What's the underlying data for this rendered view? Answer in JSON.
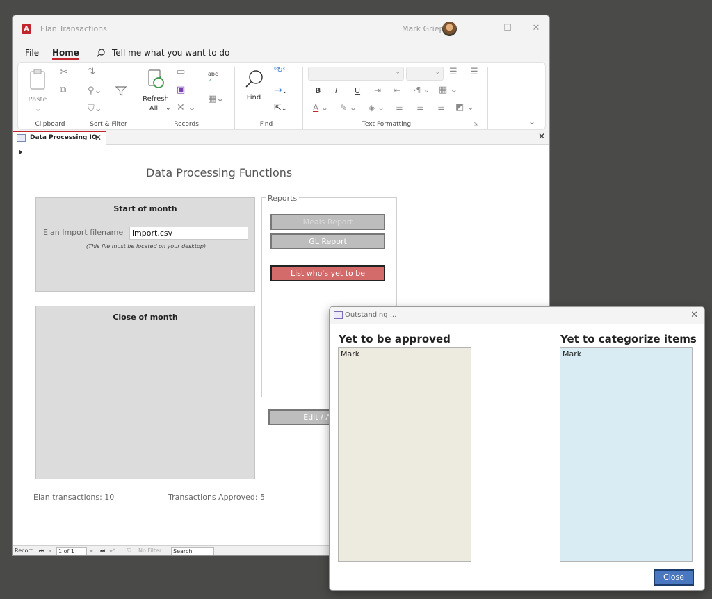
{
  "window": {
    "title": "Elan Transactions",
    "user": "Mark Griep",
    "app_icon_letter": "A",
    "controls": [
      "—",
      "☐",
      "✕"
    ]
  },
  "menu": {
    "file": "File",
    "home": "Home",
    "tell_me": "Tell me what you want to do"
  },
  "ribbon": {
    "groups": {
      "clipboard": "Clipboard",
      "sort_filter": "Sort & Filter",
      "records": "Records",
      "find": "Find",
      "text_formatting": "Text Formatting"
    },
    "buttons": {
      "paste": "Paste",
      "refresh": "Refresh",
      "refresh_all": "All",
      "find": "Find",
      "bold": "B",
      "italic": "I",
      "underline": "U"
    }
  },
  "document_tab": {
    "label": "Data Processing IO"
  },
  "form": {
    "title": "Data Processing Functions",
    "start_of_month": {
      "heading": "Start of month",
      "import_label": "Elan Import filename",
      "import_value": "import.csv",
      "note": "(This file must be located on your desktop)"
    },
    "close_of_month": {
      "heading": "Close of month"
    },
    "reports": {
      "legend": "Reports",
      "meals_report": "Meals Report",
      "gl_report": "GL Report",
      "list_unapproved": "List who's yet to be approved"
    },
    "edit_button": "Edit / Add C",
    "stats": {
      "elan_transactions": "Elan transactions: 10",
      "transactions_approved": "Transactions Approved:  5"
    }
  },
  "record_bar": {
    "record_label": "Record:",
    "position": "1 of 1",
    "filter": "No Filter",
    "search": "Search"
  },
  "dialog": {
    "title": "Outstanding ...",
    "left_heading": "Yet to be approved",
    "left_items": [
      "Mark"
    ],
    "right_heading": "Yet to categorize items",
    "right_items": [
      "Mark"
    ],
    "close_button": "Close"
  },
  "colors": {
    "accent_red": "#c0262b",
    "approved_list_bg": "#edeae0",
    "categorize_list_bg": "#d9ecf3",
    "close_button_bg": "#4a78c0",
    "list_button_bg": "#d46b6b"
  }
}
